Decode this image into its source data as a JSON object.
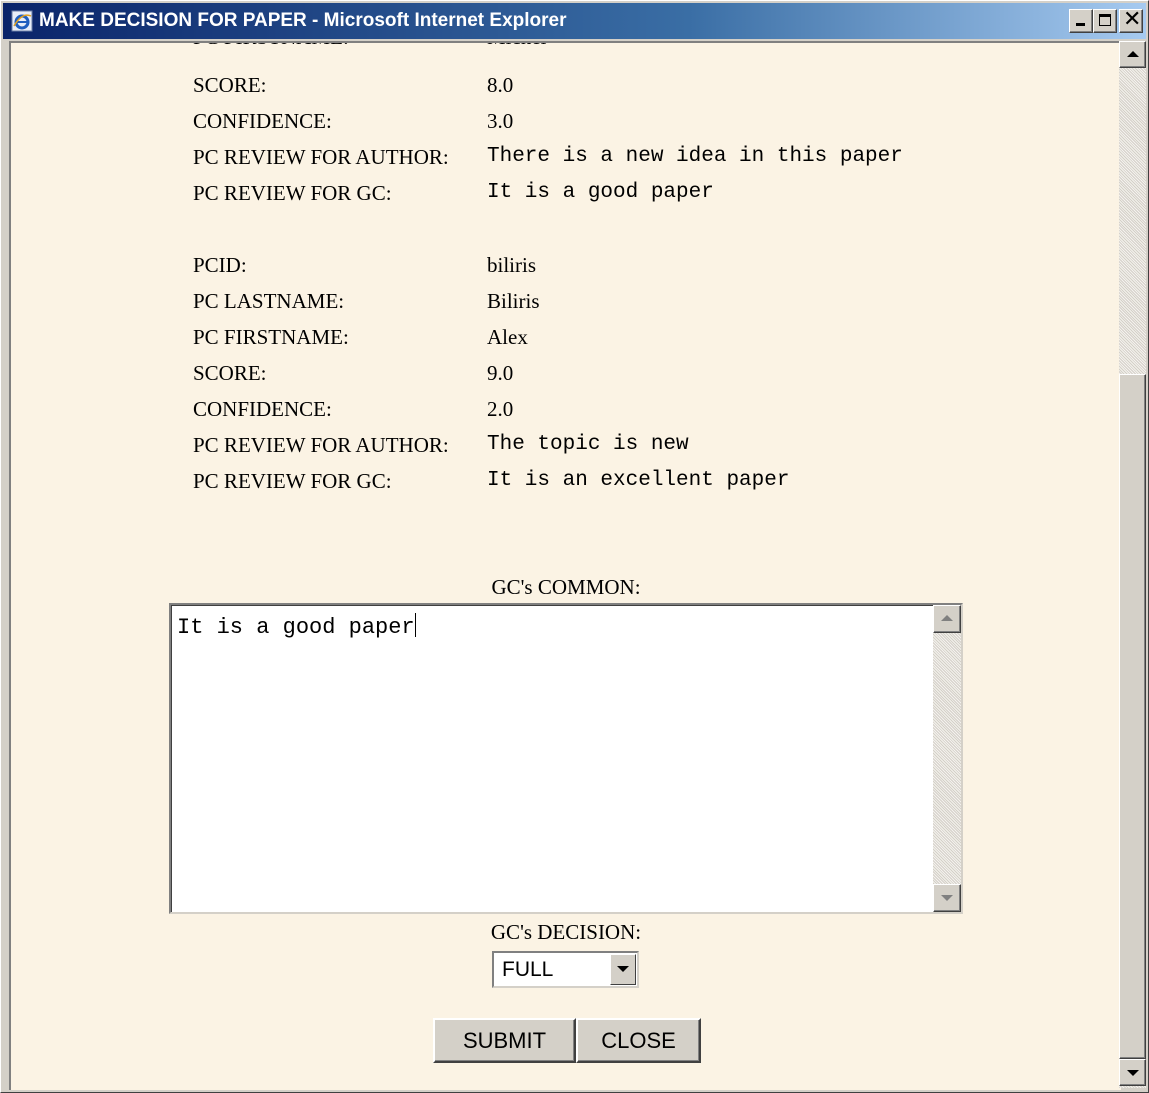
{
  "window": {
    "title": "MAKE DECISION FOR PAPER - Microsoft Internet Explorer",
    "controls": {
      "minimize": "minimize",
      "maximize": "maximize",
      "close": "close"
    }
  },
  "reviews": [
    {
      "firstname_label": "PC FIRSTNAME:",
      "firstname": "Michel",
      "score_label": "SCORE:",
      "score": "8.0",
      "confidence_label": "CONFIDENCE:",
      "confidence": "3.0",
      "review_author_label": "PC REVIEW FOR AUTHOR:",
      "review_author": "There is a new idea in this paper",
      "review_gc_label": "PC REVIEW FOR GC:",
      "review_gc": "It is a good paper"
    },
    {
      "pcid_label": "PCID:",
      "pcid": "biliris",
      "lastname_label": "PC LASTNAME:",
      "lastname": "Biliris",
      "firstname_label": "PC FIRSTNAME:",
      "firstname": "Alex",
      "score_label": "SCORE:",
      "score": "9.0",
      "confidence_label": "CONFIDENCE:",
      "confidence": "2.0",
      "review_author_label": "PC REVIEW FOR AUTHOR:",
      "review_author": "The topic is new",
      "review_gc_label": "PC REVIEW FOR GC:",
      "review_gc": "It is an excellent paper"
    }
  ],
  "form": {
    "common_label": "GC's COMMON:",
    "common_value": "It is a good paper",
    "decision_label": "GC's DECISION:",
    "decision_value": "FULL",
    "submit_label": "SUBMIT",
    "close_label": "CLOSE"
  },
  "icons": {
    "app": "ie-icon",
    "scroll_up": "arrow-up-icon",
    "scroll_down": "arrow-down-icon",
    "dropdown": "chevron-down-icon"
  },
  "colors": {
    "page_background": "#fbf3e4",
    "titlebar_start": "#0a246a",
    "titlebar_end": "#a6caf0",
    "chrome": "#d4d0c8"
  }
}
